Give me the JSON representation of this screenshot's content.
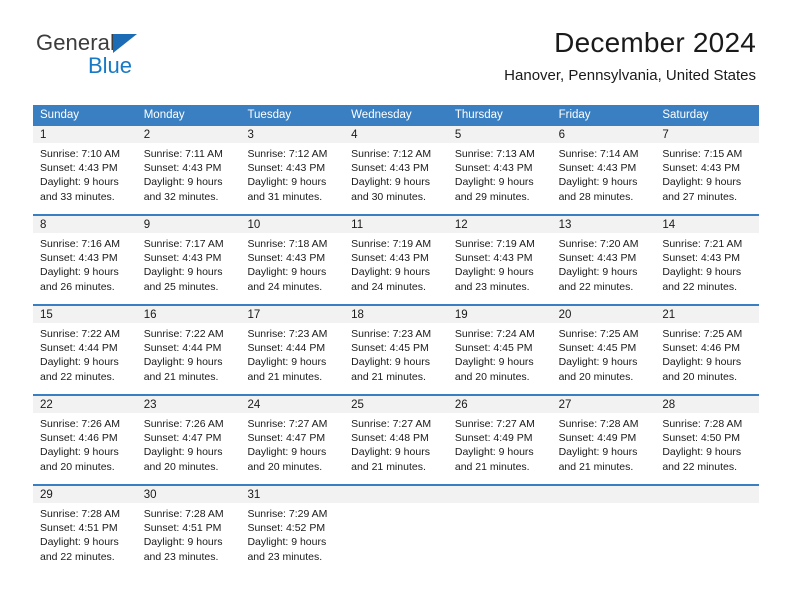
{
  "brand": {
    "name_part1": "General",
    "name_part2": "Blue",
    "accent_color": "#1879c4",
    "triangle_color": "#1b6cb5"
  },
  "header": {
    "title": "December 2024",
    "subtitle": "Hanover, Pennsylvania, United States"
  },
  "theme": {
    "header_row_bg": "#3a7fc1",
    "daynum_band_bg": "#f2f2f2",
    "separator_color": "#3a7fc1",
    "text_color": "#1a1a1a"
  },
  "weekdays": [
    "Sunday",
    "Monday",
    "Tuesday",
    "Wednesday",
    "Thursday",
    "Friday",
    "Saturday"
  ],
  "weeks": [
    {
      "days": [
        {
          "num": "1",
          "sunrise": "Sunrise: 7:10 AM",
          "sunset": "Sunset: 4:43 PM",
          "daylight1": "Daylight: 9 hours",
          "daylight2": "and 33 minutes."
        },
        {
          "num": "2",
          "sunrise": "Sunrise: 7:11 AM",
          "sunset": "Sunset: 4:43 PM",
          "daylight1": "Daylight: 9 hours",
          "daylight2": "and 32 minutes."
        },
        {
          "num": "3",
          "sunrise": "Sunrise: 7:12 AM",
          "sunset": "Sunset: 4:43 PM",
          "daylight1": "Daylight: 9 hours",
          "daylight2": "and 31 minutes."
        },
        {
          "num": "4",
          "sunrise": "Sunrise: 7:12 AM",
          "sunset": "Sunset: 4:43 PM",
          "daylight1": "Daylight: 9 hours",
          "daylight2": "and 30 minutes."
        },
        {
          "num": "5",
          "sunrise": "Sunrise: 7:13 AM",
          "sunset": "Sunset: 4:43 PM",
          "daylight1": "Daylight: 9 hours",
          "daylight2": "and 29 minutes."
        },
        {
          "num": "6",
          "sunrise": "Sunrise: 7:14 AM",
          "sunset": "Sunset: 4:43 PM",
          "daylight1": "Daylight: 9 hours",
          "daylight2": "and 28 minutes."
        },
        {
          "num": "7",
          "sunrise": "Sunrise: 7:15 AM",
          "sunset": "Sunset: 4:43 PM",
          "daylight1": "Daylight: 9 hours",
          "daylight2": "and 27 minutes."
        }
      ]
    },
    {
      "days": [
        {
          "num": "8",
          "sunrise": "Sunrise: 7:16 AM",
          "sunset": "Sunset: 4:43 PM",
          "daylight1": "Daylight: 9 hours",
          "daylight2": "and 26 minutes."
        },
        {
          "num": "9",
          "sunrise": "Sunrise: 7:17 AM",
          "sunset": "Sunset: 4:43 PM",
          "daylight1": "Daylight: 9 hours",
          "daylight2": "and 25 minutes."
        },
        {
          "num": "10",
          "sunrise": "Sunrise: 7:18 AM",
          "sunset": "Sunset: 4:43 PM",
          "daylight1": "Daylight: 9 hours",
          "daylight2": "and 24 minutes."
        },
        {
          "num": "11",
          "sunrise": "Sunrise: 7:19 AM",
          "sunset": "Sunset: 4:43 PM",
          "daylight1": "Daylight: 9 hours",
          "daylight2": "and 24 minutes."
        },
        {
          "num": "12",
          "sunrise": "Sunrise: 7:19 AM",
          "sunset": "Sunset: 4:43 PM",
          "daylight1": "Daylight: 9 hours",
          "daylight2": "and 23 minutes."
        },
        {
          "num": "13",
          "sunrise": "Sunrise: 7:20 AM",
          "sunset": "Sunset: 4:43 PM",
          "daylight1": "Daylight: 9 hours",
          "daylight2": "and 22 minutes."
        },
        {
          "num": "14",
          "sunrise": "Sunrise: 7:21 AM",
          "sunset": "Sunset: 4:43 PM",
          "daylight1": "Daylight: 9 hours",
          "daylight2": "and 22 minutes."
        }
      ]
    },
    {
      "days": [
        {
          "num": "15",
          "sunrise": "Sunrise: 7:22 AM",
          "sunset": "Sunset: 4:44 PM",
          "daylight1": "Daylight: 9 hours",
          "daylight2": "and 22 minutes."
        },
        {
          "num": "16",
          "sunrise": "Sunrise: 7:22 AM",
          "sunset": "Sunset: 4:44 PM",
          "daylight1": "Daylight: 9 hours",
          "daylight2": "and 21 minutes."
        },
        {
          "num": "17",
          "sunrise": "Sunrise: 7:23 AM",
          "sunset": "Sunset: 4:44 PM",
          "daylight1": "Daylight: 9 hours",
          "daylight2": "and 21 minutes."
        },
        {
          "num": "18",
          "sunrise": "Sunrise: 7:23 AM",
          "sunset": "Sunset: 4:45 PM",
          "daylight1": "Daylight: 9 hours",
          "daylight2": "and 21 minutes."
        },
        {
          "num": "19",
          "sunrise": "Sunrise: 7:24 AM",
          "sunset": "Sunset: 4:45 PM",
          "daylight1": "Daylight: 9 hours",
          "daylight2": "and 20 minutes."
        },
        {
          "num": "20",
          "sunrise": "Sunrise: 7:25 AM",
          "sunset": "Sunset: 4:45 PM",
          "daylight1": "Daylight: 9 hours",
          "daylight2": "and 20 minutes."
        },
        {
          "num": "21",
          "sunrise": "Sunrise: 7:25 AM",
          "sunset": "Sunset: 4:46 PM",
          "daylight1": "Daylight: 9 hours",
          "daylight2": "and 20 minutes."
        }
      ]
    },
    {
      "days": [
        {
          "num": "22",
          "sunrise": "Sunrise: 7:26 AM",
          "sunset": "Sunset: 4:46 PM",
          "daylight1": "Daylight: 9 hours",
          "daylight2": "and 20 minutes."
        },
        {
          "num": "23",
          "sunrise": "Sunrise: 7:26 AM",
          "sunset": "Sunset: 4:47 PM",
          "daylight1": "Daylight: 9 hours",
          "daylight2": "and 20 minutes."
        },
        {
          "num": "24",
          "sunrise": "Sunrise: 7:27 AM",
          "sunset": "Sunset: 4:47 PM",
          "daylight1": "Daylight: 9 hours",
          "daylight2": "and 20 minutes."
        },
        {
          "num": "25",
          "sunrise": "Sunrise: 7:27 AM",
          "sunset": "Sunset: 4:48 PM",
          "daylight1": "Daylight: 9 hours",
          "daylight2": "and 21 minutes."
        },
        {
          "num": "26",
          "sunrise": "Sunrise: 7:27 AM",
          "sunset": "Sunset: 4:49 PM",
          "daylight1": "Daylight: 9 hours",
          "daylight2": "and 21 minutes."
        },
        {
          "num": "27",
          "sunrise": "Sunrise: 7:28 AM",
          "sunset": "Sunset: 4:49 PM",
          "daylight1": "Daylight: 9 hours",
          "daylight2": "and 21 minutes."
        },
        {
          "num": "28",
          "sunrise": "Sunrise: 7:28 AM",
          "sunset": "Sunset: 4:50 PM",
          "daylight1": "Daylight: 9 hours",
          "daylight2": "and 22 minutes."
        }
      ]
    },
    {
      "days": [
        {
          "num": "29",
          "sunrise": "Sunrise: 7:28 AM",
          "sunset": "Sunset: 4:51 PM",
          "daylight1": "Daylight: 9 hours",
          "daylight2": "and 22 minutes."
        },
        {
          "num": "30",
          "sunrise": "Sunrise: 7:28 AM",
          "sunset": "Sunset: 4:51 PM",
          "daylight1": "Daylight: 9 hours",
          "daylight2": "and 23 minutes."
        },
        {
          "num": "31",
          "sunrise": "Sunrise: 7:29 AM",
          "sunset": "Sunset: 4:52 PM",
          "daylight1": "Daylight: 9 hours",
          "daylight2": "and 23 minutes."
        },
        {
          "num": "",
          "sunrise": "",
          "sunset": "",
          "daylight1": "",
          "daylight2": ""
        },
        {
          "num": "",
          "sunrise": "",
          "sunset": "",
          "daylight1": "",
          "daylight2": ""
        },
        {
          "num": "",
          "sunrise": "",
          "sunset": "",
          "daylight1": "",
          "daylight2": ""
        },
        {
          "num": "",
          "sunrise": "",
          "sunset": "",
          "daylight1": "",
          "daylight2": ""
        }
      ]
    }
  ]
}
